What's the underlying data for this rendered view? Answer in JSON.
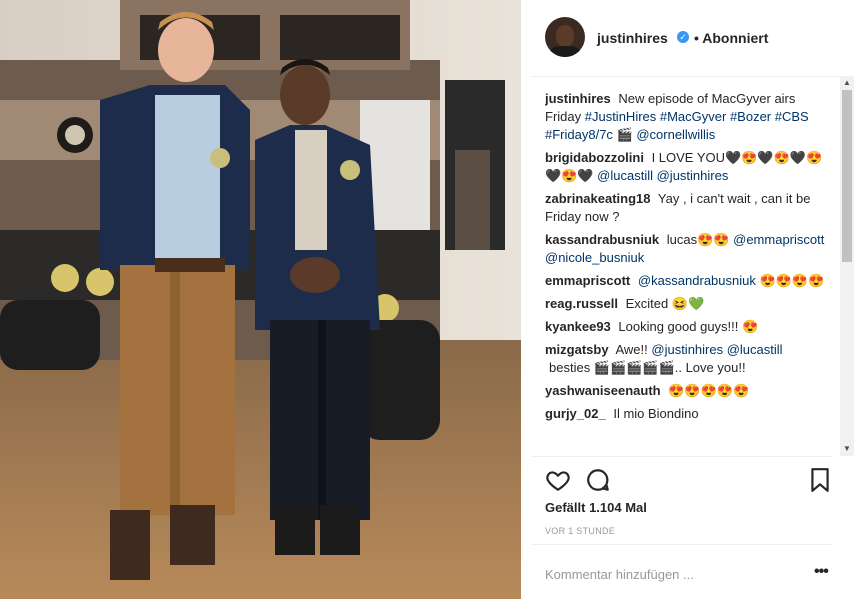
{
  "post": {
    "author": "justinhires",
    "follow_status": "• Abonniert",
    "verified_glyph": "✓"
  },
  "comments": [
    {
      "user": "justinhires",
      "text": "New episode of MacGyver airs Friday ",
      "tags": "#JustinHires #MacGyver #Bozer #CBS #Friday8/7c 🎬 @cornellwillis"
    },
    {
      "user": "brigidabozzolini",
      "text": "I LOVE YOU🖤😍🖤😍🖤😍🖤😍🖤 ",
      "tags": "@lucastill @justinhires"
    },
    {
      "user": "zabrinakeating18",
      "text": "Yay , i can't wait , can it be Friday now ?",
      "tags": ""
    },
    {
      "user": "kassandrabusniuk",
      "text": "lucas😍😍 ",
      "tags": "@emmapriscott @nicole_busniuk"
    },
    {
      "user": "emmapriscott",
      "text": "",
      "tags": "@kassandrabusniuk 😍😍😍😍"
    },
    {
      "user": "reag.russell",
      "text": "Excited 😆💚",
      "tags": ""
    },
    {
      "user": "kyankee93",
      "text": "Looking good guys!!! 😍",
      "tags": ""
    },
    {
      "user": "mizgatsby",
      "text": "Awe!! ",
      "tags": "@justinhires @lucastill"
    },
    {
      "user": "",
      "text": "besties 🎬🎬🎬🎬🎬.. Love you!!",
      "tags": ""
    },
    {
      "user": "yashwaniseenauth",
      "text": "😍😍😍😍😍",
      "tags": ""
    },
    {
      "user": "gurjy_02_",
      "text": "Il mio Biondino",
      "tags": ""
    }
  ],
  "likes": "Gefällt 1.104 Mal",
  "time": "VOR 1 STUNDE",
  "comment_placeholder": "Kommentar hinzufügen ...",
  "more_glyph": "•••",
  "scroll": {
    "up": "▲",
    "down": "▼"
  },
  "icons": {
    "like": "heart-icon",
    "comment": "comment-icon",
    "save": "bookmark-icon"
  },
  "colors": {
    "link": "#003569",
    "verified": "#3897f0"
  }
}
